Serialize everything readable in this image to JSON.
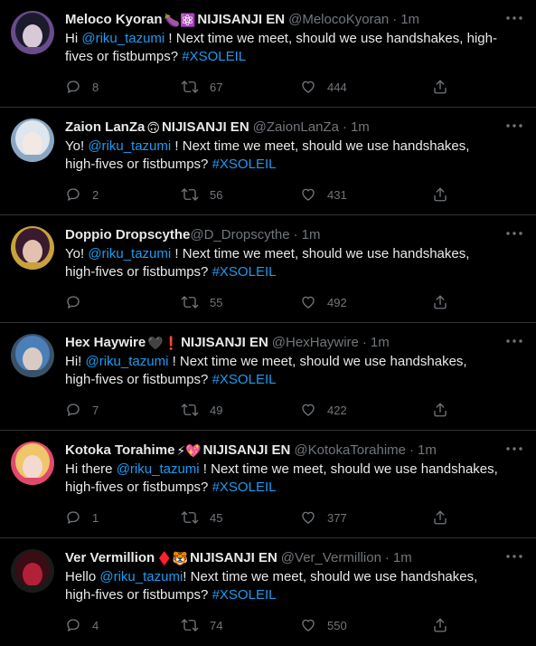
{
  "tweets": [
    {
      "name": "Meloco Kyoran",
      "emojis": "🍆⚛️",
      "org": "NIJISANJI EN",
      "handle": "@MelocoKyoran",
      "time": "1m",
      "prefix": "Hi ",
      "mention": "@riku_tazumi",
      "body": " ! Next time we meet, should we use handshakes, high-fives or fistbumps? ",
      "hashtag": "#XSOLEIL",
      "replies": "8",
      "retweets": "67",
      "likes": "444",
      "avatar_colors": [
        "#1c1b2e",
        "#d8c9d6",
        "#6a4b8c"
      ]
    },
    {
      "name": "Zaion LanZa",
      "emojis": "🙃",
      "org": "NIJISANJI EN",
      "handle": "@ZaionLanZa",
      "time": "1m",
      "prefix": "Yo! ",
      "mention": "@riku_tazumi",
      "body": " ! Next time we meet, should we use handshakes, high-fives or fistbumps? ",
      "hashtag": "#XSOLEIL",
      "replies": "2",
      "retweets": "56",
      "likes": "431",
      "avatar_colors": [
        "#dfe6ee",
        "#f2e9e4",
        "#8aa7c2"
      ]
    },
    {
      "name": "Doppio Dropscythe",
      "emojis": "",
      "org": "",
      "handle": "@D_Dropscythe",
      "time": "1m",
      "prefix": "Yo! ",
      "mention": "@riku_tazumi",
      "body": " ! Next time we meet, should we use handshakes, high-fives or fistbumps? ",
      "hashtag": "#XSOLEIL",
      "replies": "",
      "retweets": "55",
      "likes": "492",
      "avatar_colors": [
        "#3a1a2e",
        "#e2c1b0",
        "#c8a23a"
      ]
    },
    {
      "name": "Hex Haywire",
      "emojis": "🖤❗",
      "org": "NIJISANJI EN",
      "handle": "@HexHaywire",
      "time": "1m",
      "prefix": "Hi! ",
      "mention": "@riku_tazumi",
      "body": " ! Next time we meet, should we use handshakes, high-fives or fistbumps? ",
      "hashtag": "#XSOLEIL",
      "replies": "7",
      "retweets": "49",
      "likes": "422",
      "avatar_colors": [
        "#4a7fb8",
        "#d9cbc4",
        "#3a5168"
      ]
    },
    {
      "name": "Kotoka Torahime",
      "emojis": "⚡💖",
      "org": "NIJISANJI EN",
      "handle": "@KotokaTorahime",
      "time": "1m",
      "prefix": "Hi there ",
      "mention": "@riku_tazumi",
      "body": " ! Next time we meet, should we use handshakes, high-fives or fistbumps? ",
      "hashtag": "#XSOLEIL",
      "replies": "1",
      "retweets": "45",
      "likes": "377",
      "avatar_colors": [
        "#f0c66a",
        "#f4d9d0",
        "#e04a6a"
      ]
    },
    {
      "name": "Ver Vermillion",
      "emojis": "♦️🐯",
      "org": "NIJISANJI EN",
      "handle": "@Ver_Vermillion",
      "time": "1m",
      "prefix": "Hello ",
      "mention": "@riku_tazumi",
      "body": "! Next time we meet, should we use handshakes, high-fives or fistbumps? ",
      "hashtag": "#XSOLEIL",
      "replies": "4",
      "retweets": "74",
      "likes": "550",
      "avatar_colors": [
        "#3a0c14",
        "#b3203a",
        "#1a1a1a"
      ]
    }
  ],
  "colors": {
    "background": "#000000",
    "text": "#e7e9ea",
    "muted": "#71767b",
    "link": "#1d9bf0",
    "divider": "#2f3336"
  },
  "icons": {
    "more": "more-dots-icon",
    "reply": "reply-bubble-icon",
    "retweet": "retweet-icon",
    "like": "heart-icon",
    "share": "share-icon"
  }
}
